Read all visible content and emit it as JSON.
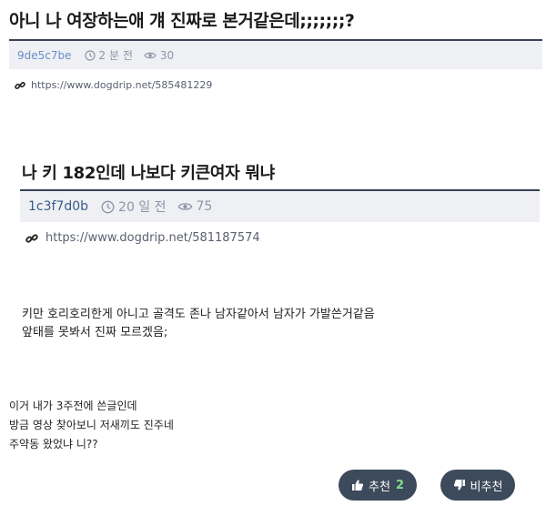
{
  "post1": {
    "title": "아니 나 여장하는애 걔 진짜로 본거같은데;;;;;;;?",
    "id": "9de5c7be",
    "time": "2 분 전",
    "views": "30",
    "link": "https://www.dogdrip.net/585481229"
  },
  "post2": {
    "title": "나 키 182인데 나보다 키큰여자 뭐냐",
    "id": "1c3f7d0b",
    "time": "20 일 전",
    "views": "75",
    "link": "https://www.dogdrip.net/581187574",
    "body_lines": [
      "키만 호리호리한게 아니고 골격도 존나 남자같아서 남자가 가발쓴거같음",
      "앞태를 못봐서 진짜 모르겠음;"
    ]
  },
  "body": {
    "lines": [
      "이거 내가 3주전에 쓴글인데",
      "방금 영상 찾아보니 저새끼도 진주네",
      "주약동 왔었냐 니??"
    ]
  },
  "buttons": {
    "upvote_label": "추천",
    "upvote_count": "2",
    "downvote_label": "비추천"
  },
  "colors": {
    "accent_dark": "#3d4a5c",
    "meta_bg": "#eef0f4",
    "id_color": "#6a8fc7",
    "count_green": "#7fe08a"
  }
}
